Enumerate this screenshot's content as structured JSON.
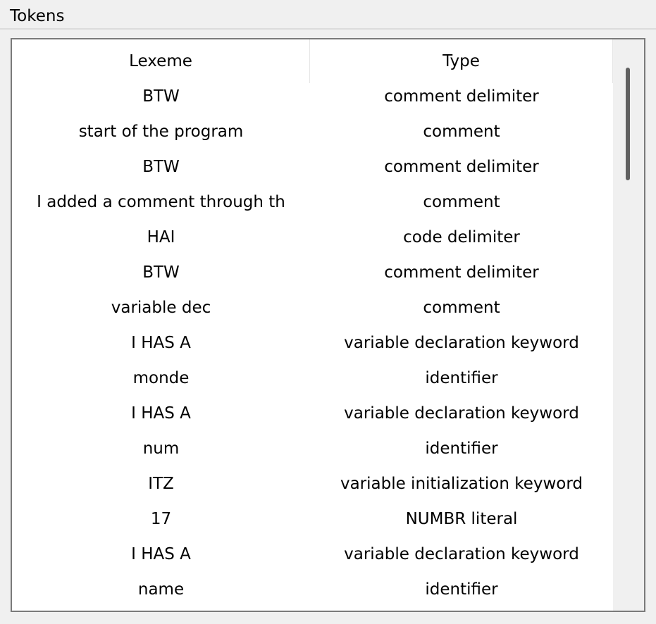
{
  "panel": {
    "title": "Tokens"
  },
  "table": {
    "columns": [
      "Lexeme",
      "Type"
    ],
    "rows": [
      [
        "BTW",
        "comment delimiter"
      ],
      [
        "start of the program",
        "comment"
      ],
      [
        "BTW",
        "comment delimiter"
      ],
      [
        "I added a comment through th",
        "comment"
      ],
      [
        "HAI",
        "code delimiter"
      ],
      [
        "BTW",
        "comment delimiter"
      ],
      [
        "variable dec",
        "comment"
      ],
      [
        "I HAS A",
        "variable declaration keyword"
      ],
      [
        "monde",
        "identifier"
      ],
      [
        "I HAS A",
        "variable declaration keyword"
      ],
      [
        "num",
        "identifier"
      ],
      [
        "ITZ",
        "variable initialization keyword"
      ],
      [
        "17",
        "NUMBR literal"
      ],
      [
        "I HAS A",
        "variable declaration keyword"
      ],
      [
        "name",
        "identifier"
      ]
    ]
  },
  "scrollbar": {
    "position": 0.0,
    "visible_fraction": 0.21
  }
}
